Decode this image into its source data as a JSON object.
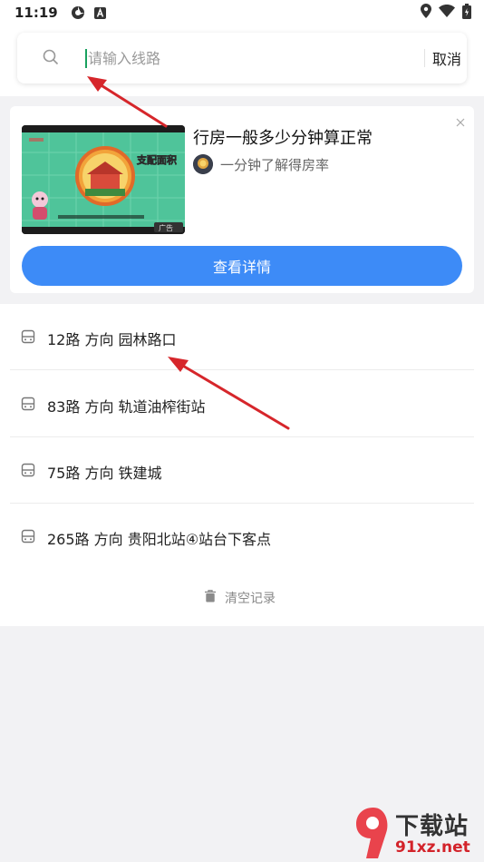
{
  "status_bar": {
    "time": "11:19"
  },
  "search": {
    "placeholder": "请输入线路",
    "value": "",
    "cancel_label": "取消"
  },
  "ad": {
    "title": "行房一般多少分钟算正常",
    "source": "一分钟了解得房率",
    "button_label": "查看详情",
    "thumb_badge": "支配面积",
    "thumb_tag": "广告"
  },
  "history": {
    "items": [
      {
        "route": "12路 方向 园林路口"
      },
      {
        "route": "83路 方向 轨道油榨街站"
      },
      {
        "route": "75路 方向 铁建城"
      },
      {
        "route": "265路 方向 贵阳北站④站台下客点"
      }
    ],
    "clear_label": "清空记录"
  },
  "watermark": {
    "title": "下载站",
    "domain": "91xz.net"
  },
  "colors": {
    "accent": "#3d8bf7",
    "annotation_arrow": "#d6262b",
    "caret": "#19a15f"
  }
}
